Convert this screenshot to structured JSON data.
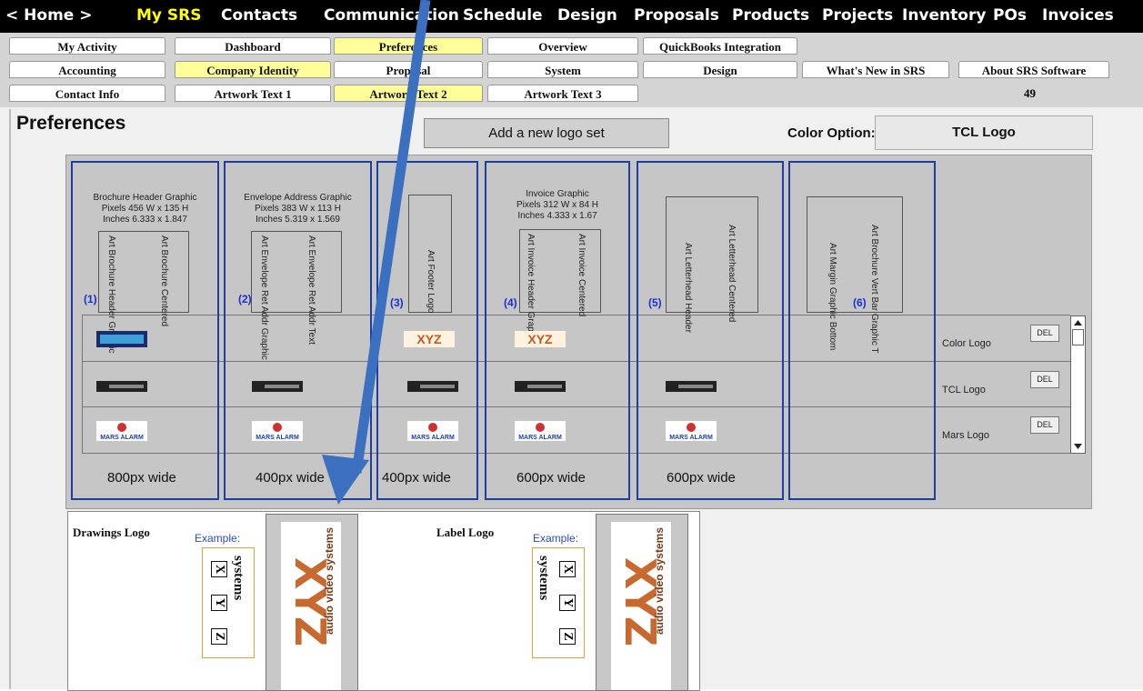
{
  "topnav": {
    "items": [
      {
        "label": "< Home >",
        "active": false
      },
      {
        "label": "My SRS",
        "active": true
      },
      {
        "label": "Contacts",
        "active": false
      },
      {
        "label": "Communication",
        "active": false
      },
      {
        "label": "Schedule",
        "active": false
      },
      {
        "label": "Design",
        "active": false
      },
      {
        "label": "Proposals",
        "active": false
      },
      {
        "label": "Products",
        "active": false
      },
      {
        "label": "Projects",
        "active": false
      },
      {
        "label": "Inventory",
        "active": false
      },
      {
        "label": "POs",
        "active": false
      },
      {
        "label": "Invoices",
        "active": false
      }
    ]
  },
  "tabs": {
    "row1": [
      "My Activity",
      "Dashboard",
      "Preferences",
      "Overview",
      "QuickBooks Integration"
    ],
    "row2": [
      "Accounting",
      "Company Identity",
      "Proposal",
      "System",
      "Design",
      "What's New in SRS",
      "About SRS Software"
    ],
    "row3": [
      "Contact Info",
      "Artwork Text 1",
      "Artwork Text 2",
      "Artwork Text 3"
    ],
    "counter": "49"
  },
  "page": {
    "title": "Preferences",
    "add_button": "Add a new logo set",
    "color_option_label": "Color Option:",
    "color_option_value": "TCL Logo"
  },
  "columns": [
    {
      "num": "(1)",
      "header": [
        "Brochure Header Graphic",
        "Pixels 456 W x 135 H",
        "Inches 6.333 x 1.847"
      ],
      "vlabels": [
        "Art Brochure Header Graphic",
        "Art Brochure Centered"
      ],
      "width": "800px wide"
    },
    {
      "num": "(2)",
      "header": [
        "Envelope Address Graphic",
        "Pixels 383 W x 113 H",
        "Inches 5.319 x 1.569"
      ],
      "vlabels": [
        "Art Envelope Ret Addr Graphic",
        "Art Envelope Ret Addr Text"
      ],
      "width": "400px wide"
    },
    {
      "num": "(3)",
      "header": [],
      "vlabels": [
        "Art Footer Logo"
      ],
      "width": "400px wide"
    },
    {
      "num": "(4)",
      "header": [
        "Invoice Graphic",
        "Pixels 312 W x 84 H",
        "Inches 4.333 x 1.67"
      ],
      "vlabels": [
        "Art Invoice Header Graphic",
        "Art Invoice Centered"
      ],
      "width": "600px wide"
    },
    {
      "num": "(5)",
      "header": [],
      "vlabels": [
        "Art Letterhead Header",
        "Art Letterhead Centered"
      ],
      "width": "600px wide"
    },
    {
      "num": "(6)",
      "header": [],
      "vlabels": [
        "Art Margin Graphic Bottom",
        "Art Brochure Vert Bar Graphic T"
      ],
      "width": ""
    }
  ],
  "logo_rows": [
    {
      "label": "Color Logo",
      "del": "DEL"
    },
    {
      "label": "TCL Logo",
      "del": "DEL"
    },
    {
      "label": "Mars Logo",
      "del": "DEL"
    }
  ],
  "logo_marks": {
    "xyz": "XYZ",
    "mars": "MARS ALARM"
  },
  "lower": {
    "drawings_label": "Drawings Logo",
    "label_label": "Label Logo",
    "example": "Example:",
    "example_letters": [
      "X",
      "Y",
      "Z"
    ],
    "example_word": "systems",
    "big_logo_letters": "XYZ",
    "big_logo_text": "audio video systems"
  },
  "colors": {
    "active_nav": "#ffff00",
    "selected_tab": "#ffff99",
    "column_border": "#1f3fa0",
    "arrow": "#3b6fc0"
  }
}
